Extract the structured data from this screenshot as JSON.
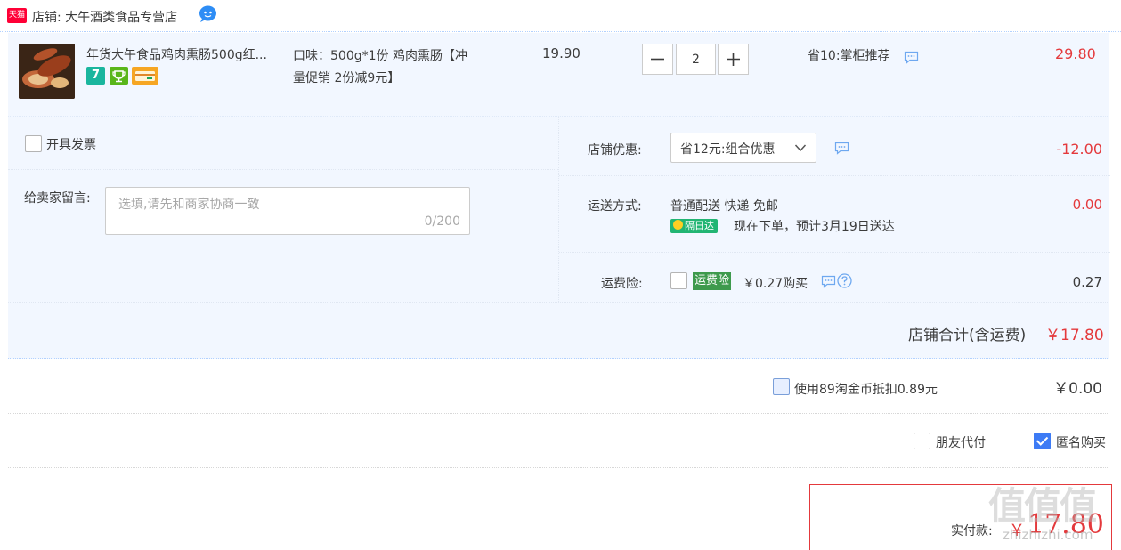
{
  "shop": {
    "logo_text": "天猫",
    "name": "店铺: 大午酒类食品专营店",
    "chat_icon": "wangwang-icon"
  },
  "item": {
    "title": "年货大午食品鸡肉熏肠500g红...",
    "badges": {
      "seven_day": "7",
      "quality": "质",
      "card": "卡"
    },
    "sku_line1": "口味：500g*1份 鸡肉熏肠【冲",
    "sku_line2": "量促销 2份减9元】",
    "unit_price": "19.90",
    "quantity": "2",
    "promo": "省10:掌柜推荐",
    "subtotal": "29.80"
  },
  "options": {
    "invoice_label": "开具发票",
    "invoice_checked": false,
    "message_label": "给卖家留言:",
    "message_placeholder": "选填,请先和商家协商一致",
    "message_count": "0/200",
    "discount_label": "店铺优惠:",
    "discount_selected": "省12元:组合优惠",
    "discount_amount": "-12.00",
    "shipping_label": "运送方式:",
    "shipping_method": "普通配送 快递 免邮",
    "express_badge": "隔日达",
    "delivery_note": "现在下单，预计3月19日送达",
    "shipping_fee": "0.00",
    "insurance_label": "运费险:",
    "insurance_badge": "运费险",
    "insurance_price": "￥0.27购买",
    "insurance_fee": "0.27",
    "shop_total_label": "店铺合计(含运费)",
    "shop_total_value": "￥17.80"
  },
  "coins": {
    "label": "使用89淘金币抵扣0.89元",
    "value": "￥0.00"
  },
  "extra": {
    "friend_pay_label": "朋友代付",
    "anonymous_label": "匿名购买",
    "anonymous_checked": true
  },
  "payment": {
    "label": "实付款:",
    "currency": "￥",
    "amount": "17.80"
  },
  "watermark": {
    "text": "值值值",
    "sub": "zhizhizhi.com"
  },
  "colors": {
    "accent_red": "#e4393c",
    "panel_bg": "#f2f7ff",
    "checkbox_blue": "#3d7bf5",
    "express_green": "#22b573"
  }
}
